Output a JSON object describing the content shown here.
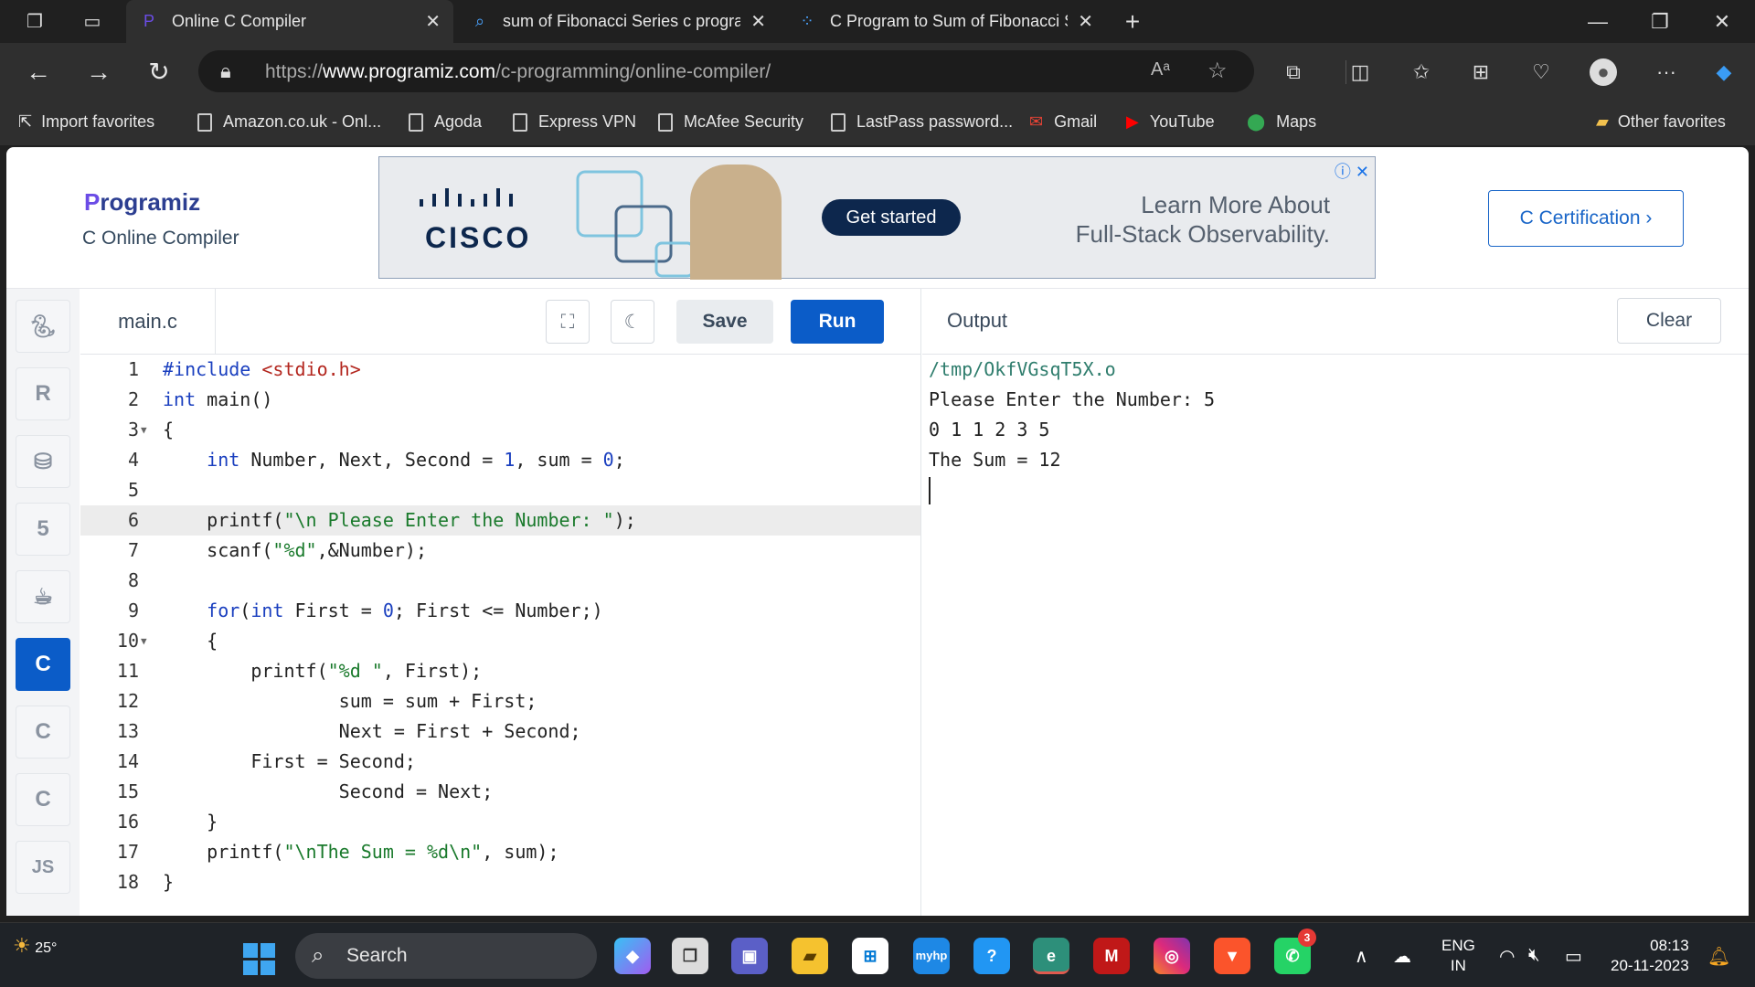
{
  "browser": {
    "tabs": [
      {
        "title": "Online C Compiler",
        "active": true
      },
      {
        "title": "sum of Fibonacci Series c progra",
        "active": false
      },
      {
        "title": "C Program to Sum of Fibonacci S",
        "active": false
      }
    ],
    "url_prefix": "https://",
    "url_domain": "www.programiz.com",
    "url_path": "/c-programming/online-compiler/",
    "bookmarks": [
      "Import favorites",
      "Amazon.co.uk - Onl...",
      "Agoda",
      "Express VPN",
      "McAfee Security",
      "LastPass password...",
      "Gmail",
      "YouTube",
      "Maps"
    ],
    "other_favorites": "Other favorites"
  },
  "header": {
    "logo": "rogramiz",
    "logo_initial": "P",
    "subtitle": "C Online Compiler",
    "ad": {
      "brand": "CISCO",
      "cta": "Get started",
      "text_line1": "Learn More About",
      "text_line2": "Full-Stack Observability."
    },
    "cert_button": "C Certification ›"
  },
  "sidebar": {
    "languages": [
      "python",
      "r",
      "sql",
      "html",
      "java",
      "c",
      "cpp",
      "csharp",
      "js"
    ],
    "active": "c",
    "js_label": "JS"
  },
  "editor": {
    "filename": "main.c",
    "save_label": "Save",
    "run_label": "Run",
    "current_line": 6
  },
  "output": {
    "label": "Output",
    "clear_label": "Clear",
    "lines": [
      "/tmp/OkfVGsqT5X.o",
      "Please Enter the Number: 5",
      "0 1 1 2 3 5",
      "The Sum = 12"
    ]
  },
  "taskbar": {
    "weather": "25°",
    "search_placeholder": "Search",
    "lang_top": "ENG",
    "lang_bottom": "IN",
    "time": "08:13",
    "date": "20-11-2023",
    "whatsapp_badge": "3"
  }
}
